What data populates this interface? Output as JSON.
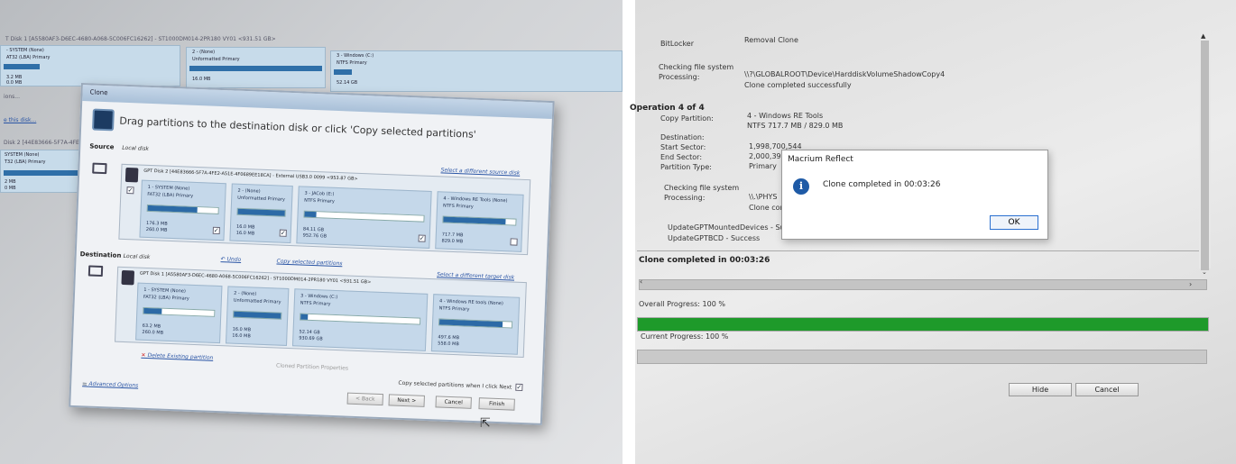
{
  "left_photo": {
    "background": {
      "disk1_header": "T Disk 1 [A5580AF3-D6EC-4680-A068-5C006FC16262] - ST1000DM014-2PR180 VY01 <931.51 GB>",
      "partitions": [
        {
          "name": "- SYSTEM (None)",
          "type": "AT32 (LBA) Primary",
          "size1": "3.2 MB",
          "size2": "0.0 MB"
        },
        {
          "name": "2 - (None)",
          "type": "Unformatted Primary",
          "size1": "16.0 MB",
          "size2": ""
        },
        {
          "name": "3 - Windows (C:)",
          "type": "NTFS Primary",
          "size1": "52.14 GB",
          "size2": ""
        }
      ],
      "misc_text": [
        "ions...",
        "e this disk...",
        "Disk 2 [44E83666-5F7A-4FE2-A5",
        "SYSTEM (None)",
        "T32 (LBA) Primary",
        "2 MB",
        "0 MB"
      ]
    },
    "dialog": {
      "title": "Clone",
      "heading": "Drag partitions to the destination disk or click 'Copy selected partitions'",
      "source_label": "Source",
      "source_sub": "Local disk",
      "select_source_link": "Select a different source disk",
      "source_disk_name": "GPT Disk 2 [44E83666-5F7A-4FE2-A51E-4F0689EE18CA] - External USB3.0        0099  <953.87 GB>",
      "source_parts": [
        {
          "name": "1 - SYSTEM (None)",
          "type": "FAT32 (LBA) Primary",
          "fill": 0.7,
          "s1": "176.3 MB",
          "s2": "260.0 MB",
          "checked": true
        },
        {
          "name": "2 - (None)",
          "type": "Unformatted Primary",
          "fill": 1.0,
          "s1": "16.0 MB",
          "s2": "16.0 MB",
          "checked": true
        },
        {
          "name": "3 - JACob (E:)",
          "type": "NTFS Primary",
          "fill": 0.1,
          "s1": "84.11 GB",
          "s2": "952.76 GB",
          "checked": true
        },
        {
          "name": "4 - Windows RE Tools (None)",
          "type": "NTFS Primary",
          "fill": 0.86,
          "s1": "717.7 MB",
          "s2": "829.0 MB",
          "checked": false
        }
      ],
      "destination_label": "Destination",
      "destination_sub": "Local disk",
      "undo": "Undo",
      "copy_selected": "Copy selected partitions",
      "select_target_link": "Select a different target disk",
      "dest_disk_name": "GPT Disk 1 [A5580AF3-D6EC-4680-A068-5C006FC16262] - ST1000DM014-2PR180 VY01  <931.51 GB>",
      "dest_parts": [
        {
          "name": "1 - SYSTEM (None)",
          "type": "FAT32 (LBA) Primary",
          "fill": 0.25,
          "s1": "63.2 MB",
          "s2": "260.0 MB"
        },
        {
          "name": "2 - (None)",
          "type": "Unformatted Primary",
          "fill": 1.0,
          "s1": "16.0 MB",
          "s2": "16.0 MB"
        },
        {
          "name": "3 - Windows (C:)",
          "type": "NTFS Primary",
          "fill": 0.06,
          "s1": "52.14 GB",
          "s2": "930.69 GB"
        },
        {
          "name": "4 - Windows RE tools (None)",
          "type": "NTFS Primary",
          "fill": 0.88,
          "s1": "497.6 MB",
          "s2": "558.0 MB"
        }
      ],
      "delete_link": "Delete Existing partition",
      "cloned_props": "Cloned Partition Properties",
      "copy_next": "Copy selected partitions when I click Next",
      "advanced": "Advanced Options",
      "back": "< Back",
      "next": "Next >",
      "cancel": "Cancel",
      "finish": "Finish"
    }
  },
  "right_photo": {
    "log": {
      "row0_label": "BitLocker",
      "row0_value": "Removal Clone",
      "check_fs": "Checking file system",
      "processing_label": "Processing:",
      "processing_value": "\\\\?\\GLOBALROOT\\Device\\HarddiskVolumeShadowCopy4",
      "clone_ok": "Clone completed successfully",
      "operation": "Operation 4 of 4",
      "copy_partition_label": "Copy Partition:",
      "copy_partition_value": "4 - Windows RE Tools",
      "copy_partition_value2": "NTFS 717.7 MB / 829.0 MB",
      "destination_label": "Destination:",
      "start_sector_label": "Start Sector:",
      "start_sector_value": "1,998,700,544",
      "end_sector_label": "End Sector:",
      "end_sector_value": "2,000,398",
      "partition_type_label": "Partition Type:",
      "partition_type_value": "Primary",
      "check_fs2": "Checking file system",
      "processing2_label": "Processing:",
      "processing2_value": "\\\\.\\PHYS",
      "clone_com": "Clone com",
      "update1": "UpdateGPTMountedDevices - Succ",
      "update2": "UpdateGPTBCD - Success"
    },
    "message_box": {
      "title": "Macrium Reflect",
      "message": "Clone completed in 00:03:26",
      "ok": "OK"
    },
    "status": "Clone completed in 00:03:26",
    "overall_label": "Overall Progress:  100 %",
    "overall_progress": 1.0,
    "current_label": "Current Progress:  100 %",
    "current_progress": 1.0,
    "hide": "Hide",
    "cancel": "Cancel",
    "colors": {
      "progress": "#1e9a2a",
      "info_icon": "#1e5aa6"
    }
  }
}
